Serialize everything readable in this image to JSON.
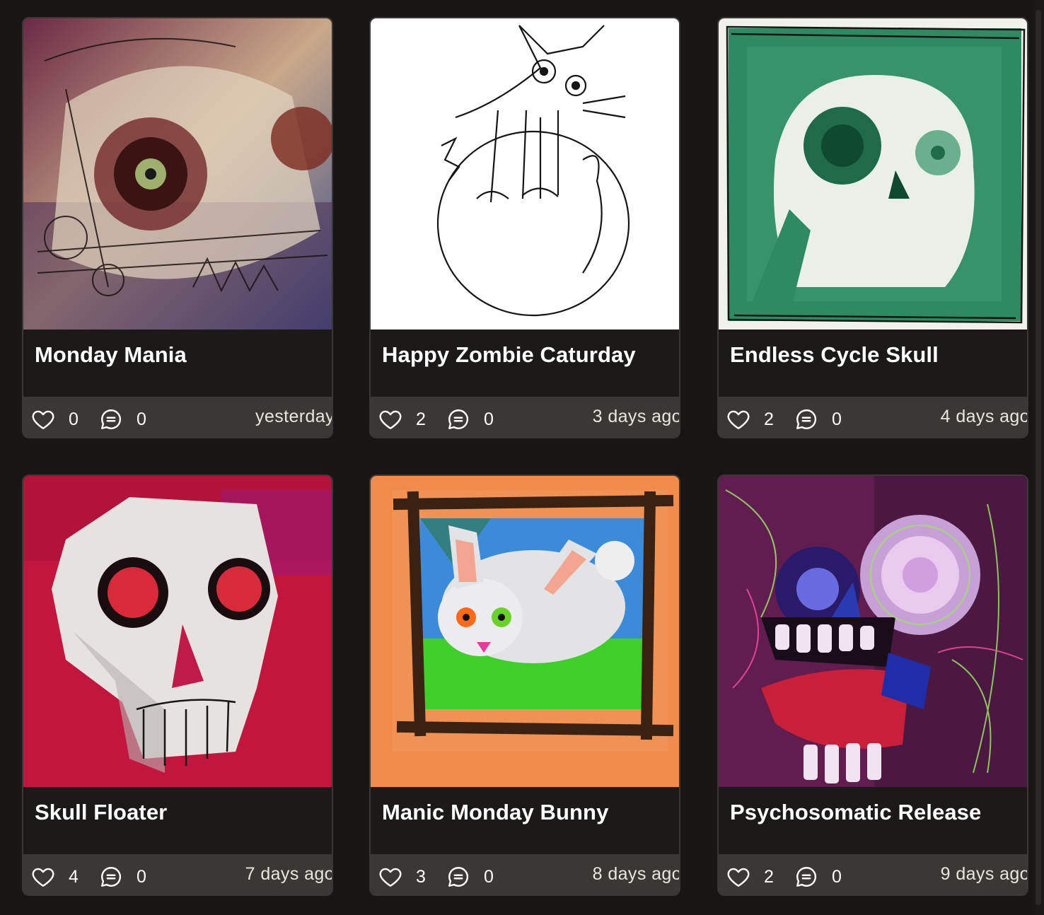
{
  "artworks": [
    {
      "title": "Monday Mania",
      "likes": "0",
      "comments": "0",
      "posted": "yesterday",
      "palette": [
        "#7a2f3a",
        "#d9c9a3",
        "#3c5a8c"
      ]
    },
    {
      "title": "Happy Zombie Caturday",
      "likes": "2",
      "comments": "0",
      "posted": "3 days ago",
      "palette": [
        "#ffffff",
        "#111111",
        "#cfcfcf"
      ]
    },
    {
      "title": "Endless Cycle Skull",
      "likes": "2",
      "comments": "0",
      "posted": "4 days ago",
      "palette": [
        "#2f8a62",
        "#e9efe8",
        "#1f5c43"
      ]
    },
    {
      "title": "Skull Floater",
      "likes": "4",
      "comments": "0",
      "posted": "7 days ago",
      "palette": [
        "#c3163f",
        "#e6e2df",
        "#8d0f2b"
      ]
    },
    {
      "title": "Manic Monday Bunny",
      "likes": "3",
      "comments": "0",
      "posted": "8 days ago",
      "palette": [
        "#f28a4b",
        "#3b8bd9",
        "#3fcf2a"
      ]
    },
    {
      "title": "Psychosomatic Release",
      "likes": "2",
      "comments": "0",
      "posted": "9 days ago",
      "palette": [
        "#6b1f57",
        "#e0b7e8",
        "#c81f3a"
      ]
    }
  ],
  "icons": {
    "like": "heart-icon",
    "comment": "comment-bubble-icon"
  },
  "colors": {
    "background": "#171615",
    "card": "#1b1a19",
    "footer": "#3a3734",
    "text": "#ffffff"
  }
}
